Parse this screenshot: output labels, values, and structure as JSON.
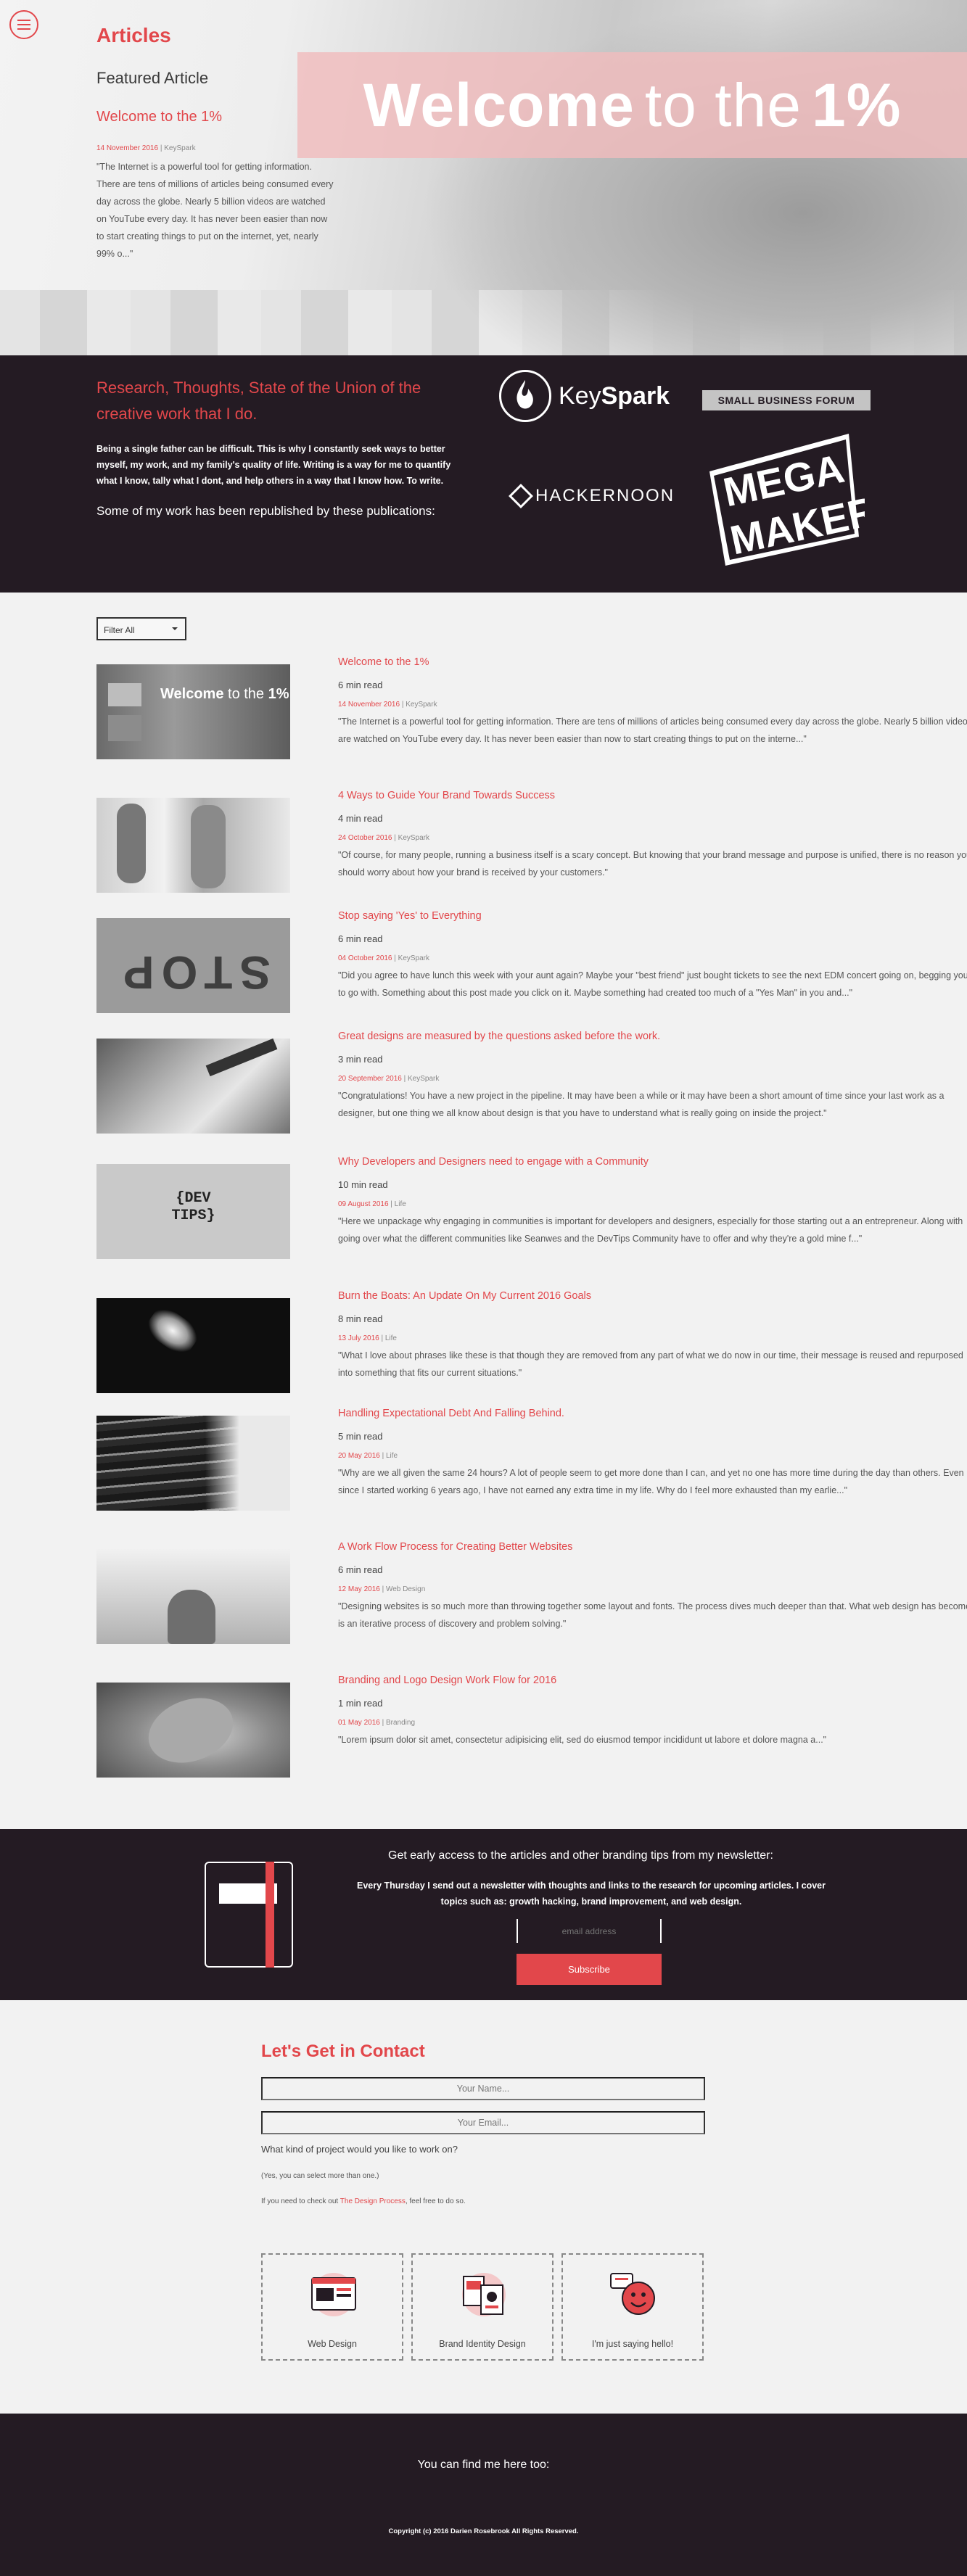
{
  "header": {
    "page_title": "Articles",
    "featured_label": "Featured Article"
  },
  "featured": {
    "title": "Welcome to the 1%",
    "banner": {
      "bold1": "Welcome",
      "thin": "to the",
      "bold2": "1%"
    },
    "date": "14 November 2016",
    "author": "KeySpark",
    "excerpt": "\"The Internet is a powerful tool for getting information. There are tens of millions of articles being consumed every day across the globe. Nearly 5 billion videos are watched on YouTube every day. It has never been easier than now to start creating things to put on the internet, yet, nearly 99% o...\""
  },
  "about": {
    "heading": "Research, Thoughts, State of the Union of the creative work that I do.",
    "blurb": "Being a single father can be difficult. This is why I constantly seek ways to better myself, my work, and my family's quality of life. Writing is a way for me to quantify what I know, tally what I dont, and help others in a way that I know how. To write.",
    "republished": "Some of my work has been republished by these publications:",
    "logos": {
      "keyspark_a": "Key",
      "keyspark_b": "Spark",
      "sbf": "SMALL BUSINESS FORUM",
      "hackernoon": "HACKERNOON",
      "megamaker_1": "MEGA",
      "megamaker_2": "MAKER"
    }
  },
  "filter": {
    "selected": "Filter All"
  },
  "articles": [
    {
      "title": "Welcome to the 1%",
      "read": "6 min read",
      "date": "14 November 2016",
      "author": "KeySpark",
      "excerpt": "\"The Internet is a powerful tool for getting information. There are tens of millions of articles being consumed every day across the globe. Nearly 5 billion videos are watched on YouTube every day. It has never been easier than now to start creating things to put on the interne...\""
    },
    {
      "title": "4 Ways to Guide Your Brand Towards Success",
      "read": "4 min read",
      "date": "24 October 2016",
      "author": "KeySpark",
      "excerpt": "\"Of course, for many people, running a business itself is a scary concept. But knowing that your brand message and purpose is unified, there is no reason you should worry about how your brand is received by your customers.\""
    },
    {
      "title": "Stop saying 'Yes' to Everything",
      "read": "6 min read",
      "date": "04 October 2016",
      "author": "KeySpark",
      "excerpt": "\"Did you agree to have lunch this week with your aunt again? Maybe your \"best friend\" just bought tickets to see the next EDM concert going on, begging you to go with. Something about this post made you click on it. Maybe something had created too much of a \"Yes Man\" in you and...\""
    },
    {
      "title": "Great designs are measured by the questions asked before the work.",
      "read": "3 min read",
      "date": "20 September 2016",
      "author": "KeySpark",
      "excerpt": "\"Congratulations! You have a new project in the pipeline. It may have been a while or it may have been a short amount of time since your last work as a designer, but one thing we all know about design is that you have to understand what is really going on inside the project.\""
    },
    {
      "title": "Why Developers and Designers need to engage with a Community",
      "read": "10 min read",
      "date": "09 August 2016",
      "author": "Life",
      "excerpt": "\"Here we unpackage why engaging in communities is important for developers and designers, especially for those starting out a an entrepreneur. Along with going over what the different communities like Seanwes and the DevTips Community have to offer and why they're a gold mine f...\""
    },
    {
      "title": "Burn the Boats: An Update On My Current 2016 Goals",
      "read": "8 min read",
      "date": "13 July 2016",
      "author": "Life",
      "excerpt": "\"What I love about phrases like these is that though they are removed from any part of what we do now in our time, their message is reused and repurposed into something that fits our current situations.\""
    },
    {
      "title": "Handling Expectational Debt And Falling Behind.",
      "read": "5 min read",
      "date": "20 May 2016",
      "author": "Life",
      "excerpt": "\"Why are we all given the same 24 hours? A lot of people seem to get more done than I can, and yet no one has more time during the day than others. Even since I started working 6 years ago, I have not earned any extra time in my life. Why do I feel more exhausted than my earlie...\""
    },
    {
      "title": "A Work Flow Process for Creating Better Websites",
      "read": "6 min read",
      "date": "12 May 2016",
      "author": "Web Design",
      "excerpt": "\"Designing websites is so much more than throwing together some layout and fonts. The process dives much deeper than that. What web design has become is an iterative process of discovery and problem solving.\""
    },
    {
      "title": "Branding and Logo Design Work Flow for 2016",
      "read": "1 min read",
      "date": "01 May 2016",
      "author": "Branding",
      "excerpt": "\"Lorem ipsum dolor sit amet, consectetur adipisicing elit, sed do eiusmod tempor incididunt ut labore et dolore magna a...\""
    }
  ],
  "thumbs": {
    "welcome_bold": "Welcome",
    "welcome_thin": "to the",
    "welcome_pct": "1%",
    "stop": "STOP",
    "dev": "{DEV",
    "tips": "TIPS}"
  },
  "newsletter": {
    "title": "Get early access to the articles and other branding tips from my newsletter:",
    "desc": "Every Thursday I send out a newsletter with thoughts and links to the research for upcoming articles. I cover topics such as: growth hacking, brand improvement, and web design.",
    "email_placeholder": "email address",
    "subscribe": "Subscribe"
  },
  "contact": {
    "title": "Let's Get in Contact",
    "name_placeholder": "Your Name...",
    "email_placeholder": "Your Email...",
    "question": "What kind of project would you like to work on?",
    "select_note": "(Yes, you can select more than one.)",
    "process_pre": "If you need to check out",
    "process_link": "The Design Process",
    "process_post": ", feel free to do so.",
    "options": [
      "Web Design",
      "Brand Identity Design",
      "I'm just saying hello!"
    ]
  },
  "footer": {
    "find_me": "You can find me here too:",
    "copyright": "Copyright (c) 2016 Darien Rosebrook All Rights Reserved."
  },
  "colors": {
    "accent": "#e2474b",
    "dark": "#241b23",
    "bg": "#f2f2f2"
  }
}
